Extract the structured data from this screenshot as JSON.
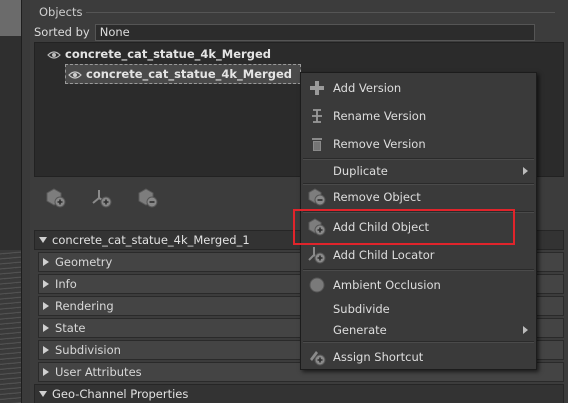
{
  "panel": {
    "title": "Objects"
  },
  "sort": {
    "label": "Sorted by",
    "value": "None"
  },
  "objects": [
    {
      "name": "concrete_cat_statue_4k_Merged",
      "selected": false
    },
    {
      "name": "concrete_cat_statue_4k_Merged",
      "selected": true
    }
  ],
  "toolbar": {
    "icons": [
      "add-object-icon",
      "add-locator-icon",
      "remove-object-icon"
    ]
  },
  "properties": {
    "root": "concrete_cat_statue_4k_Merged_1",
    "groups": [
      "Geometry",
      "Info",
      "Rendering",
      "State",
      "Subdivision",
      "User Attributes"
    ],
    "last": "Geo-Channel Properties"
  },
  "context_menu": {
    "items": [
      {
        "label": "Add Version",
        "icon": "add-version-icon"
      },
      {
        "label": "Rename Version",
        "icon": "rename-version-icon"
      },
      {
        "label": "Remove Version",
        "icon": "trash-icon"
      },
      {
        "label": "Duplicate",
        "submenu": true
      },
      {
        "label": "Remove Object",
        "icon": "remove-object-icon"
      },
      {
        "label": "Add Child Object",
        "icon": "add-child-object-icon",
        "highlighted": true
      },
      {
        "label": "Add Child Locator",
        "icon": "add-child-locator-icon"
      },
      {
        "label": "Ambient Occlusion",
        "icon": "sphere-icon"
      },
      {
        "label": "Subdivide"
      },
      {
        "label": "Generate",
        "submenu": true
      },
      {
        "label": "Assign Shortcut",
        "icon": "shortcut-icon"
      }
    ]
  },
  "colors": {
    "highlight_outline": "#e0242b",
    "panel_bg": "#3c3c3c",
    "menu_bg": "#3a3a3a"
  }
}
